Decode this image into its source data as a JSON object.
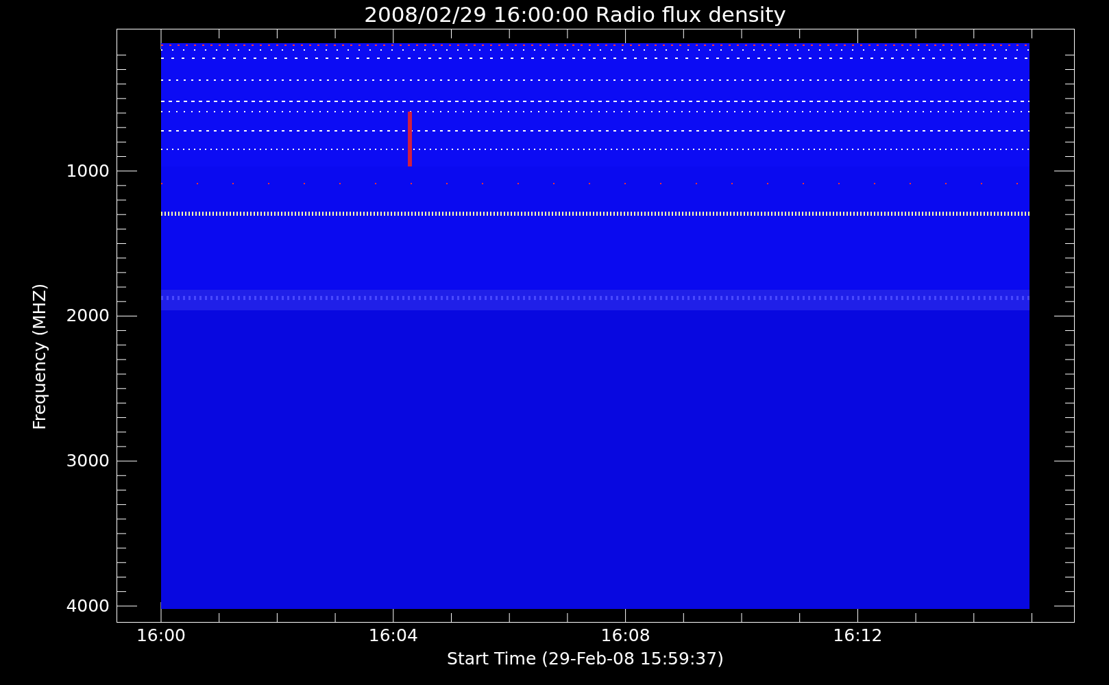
{
  "title": "2008/02/29 16:00:00 Radio flux density",
  "y_axis": {
    "label": "Frequency (MHZ)",
    "ticks": [
      "1000",
      "2000",
      "3000",
      "4000"
    ]
  },
  "x_axis": {
    "label": "Start Time (29-Feb-08 15:59:37)",
    "ticks": [
      "16:00",
      "16:04",
      "16:08",
      "16:12"
    ]
  }
}
